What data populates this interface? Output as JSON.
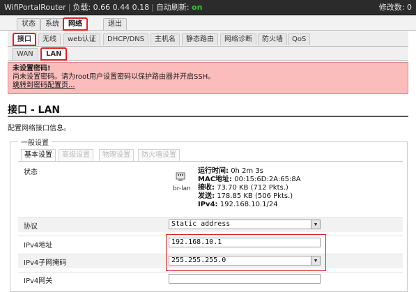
{
  "topbar": {
    "router_name": "WifiPortalRouter",
    "load_label": "负载:",
    "load_value": "0.66 0.44 0.18",
    "refresh_label": "自动刷新:",
    "refresh_value": "on",
    "changes_label": "修改数:",
    "changes_value": "0"
  },
  "menu1": [
    {
      "label": "状态"
    },
    {
      "label": "系统"
    },
    {
      "label": "网络"
    },
    {
      "label": "退出"
    }
  ],
  "menu2": [
    {
      "label": "接口"
    },
    {
      "label": "无线"
    },
    {
      "label": "web认证"
    },
    {
      "label": "DHCP/DNS"
    },
    {
      "label": "主机名"
    },
    {
      "label": "静态路由"
    },
    {
      "label": "网络诊断"
    },
    {
      "label": "防火墙"
    },
    {
      "label": "QoS"
    }
  ],
  "menu3": [
    {
      "label": "WAN"
    },
    {
      "label": "LAN"
    }
  ],
  "alert": {
    "title": "未设置密码!",
    "message": "尚未设置密码。请为root用户设置密码以保护路由器并开启SSH。",
    "link": "跳转到密码配置页..."
  },
  "page": {
    "title": "接口 - LAN",
    "description": "配置网络接口信息。"
  },
  "section": {
    "legend": "一般设置",
    "subtabs": [
      {
        "label": "基本设置"
      },
      {
        "label": "高级设置"
      },
      {
        "label": "物理设置"
      },
      {
        "label": "防火墙设置"
      }
    ]
  },
  "status": {
    "label": "状态",
    "interface": "br-lan",
    "uptime_label": "运行时间:",
    "uptime": "0h 2m 3s",
    "mac_label": "MAC地址:",
    "mac": "00:15:6D:2A:65:8A",
    "rx_label": "接收:",
    "rx": "73.70 KB (712 Pkts.)",
    "tx_label": "发送:",
    "tx": "178.85 KB (506 Pkts.)",
    "ipv4_label": "IPv4:",
    "ipv4": "192.168.10.1/24"
  },
  "form": {
    "protocol_label": "协议",
    "protocol_value": "Static address",
    "ipv4_addr_label": "IPv4地址",
    "ipv4_addr_value": "192.168.10.1",
    "netmask_label": "IPv4子网掩码",
    "netmask_value": "255.255.255.0",
    "gateway_label": "IPv4网关",
    "gateway_value": ""
  }
}
